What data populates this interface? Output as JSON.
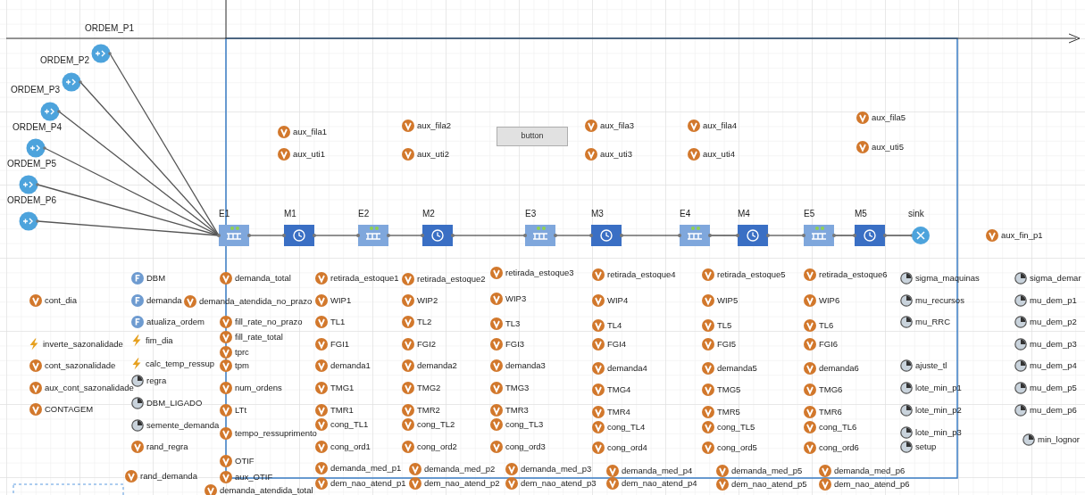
{
  "flowchart": {
    "blocks": [
      {
        "kind": "source",
        "label": "ORDEM_P1"
      },
      {
        "kind": "source",
        "label": "ORDEM_P2"
      },
      {
        "kind": "source",
        "label": "ORDEM_P3"
      },
      {
        "kind": "source",
        "label": "ORDEM_P4"
      },
      {
        "kind": "source",
        "label": "ORDEM_P5"
      },
      {
        "kind": "source",
        "label": "ORDEM_P6"
      },
      {
        "kind": "queue",
        "label": "E1"
      },
      {
        "kind": "delay",
        "label": "M1"
      },
      {
        "kind": "queue",
        "label": "E2"
      },
      {
        "kind": "delay",
        "label": "M2"
      },
      {
        "kind": "queue",
        "label": "E3"
      },
      {
        "kind": "delay",
        "label": "M3"
      },
      {
        "kind": "queue",
        "label": "E4"
      },
      {
        "kind": "delay",
        "label": "M4"
      },
      {
        "kind": "queue",
        "label": "E5"
      },
      {
        "kind": "delay",
        "label": "M5"
      },
      {
        "kind": "sink",
        "label": "sink"
      }
    ]
  },
  "button": {
    "label": "button"
  },
  "elements": [
    {
      "kind": "variable",
      "name": "aux_fila1"
    },
    {
      "kind": "variable",
      "name": "aux_uti1"
    },
    {
      "kind": "variable",
      "name": "aux_fila2"
    },
    {
      "kind": "variable",
      "name": "aux_uti2"
    },
    {
      "kind": "variable",
      "name": "aux_fila3"
    },
    {
      "kind": "variable",
      "name": "aux_uti3"
    },
    {
      "kind": "variable",
      "name": "aux_fila4"
    },
    {
      "kind": "variable",
      "name": "aux_uti4"
    },
    {
      "kind": "variable",
      "name": "aux_fila5"
    },
    {
      "kind": "variable",
      "name": "aux_uti5"
    },
    {
      "kind": "variable",
      "name": "aux_fin_p1"
    },
    {
      "kind": "variable",
      "name": "cont_dia"
    },
    {
      "kind": "event",
      "name": "inverte_sazonalidade"
    },
    {
      "kind": "variable",
      "name": "cont_sazonalidade"
    },
    {
      "kind": "variable",
      "name": "aux_cont_sazonalidade"
    },
    {
      "kind": "variable",
      "name": "CONTAGEM"
    },
    {
      "kind": "function",
      "name": "DBM"
    },
    {
      "kind": "function",
      "name": "demanda"
    },
    {
      "kind": "function",
      "name": "atualiza_ordem"
    },
    {
      "kind": "event",
      "name": "fim_dia"
    },
    {
      "kind": "event",
      "name": "calc_temp_ressup"
    },
    {
      "kind": "parameter",
      "name": "regra"
    },
    {
      "kind": "parameter",
      "name": "DBM_LIGADO"
    },
    {
      "kind": "parameter",
      "name": "semente_demanda"
    },
    {
      "kind": "variable",
      "name": "rand_regra"
    },
    {
      "kind": "variable",
      "name": "rand_demanda"
    },
    {
      "kind": "variable",
      "name": "demanda_total"
    },
    {
      "kind": "variable",
      "name": "demanda_atendida_no_prazo"
    },
    {
      "kind": "variable",
      "name": "fill_rate_no_prazo"
    },
    {
      "kind": "variable",
      "name": "fill_rate_total"
    },
    {
      "kind": "variable",
      "name": "tprc"
    },
    {
      "kind": "variable",
      "name": "tpm"
    },
    {
      "kind": "variable",
      "name": "num_ordens"
    },
    {
      "kind": "variable",
      "name": "LTt"
    },
    {
      "kind": "variable",
      "name": "tempo_ressuprimento"
    },
    {
      "kind": "variable",
      "name": "OTIF"
    },
    {
      "kind": "variable",
      "name": "aux_OTIF"
    },
    {
      "kind": "variable",
      "name": "demanda_atendida_total"
    },
    {
      "kind": "variable",
      "name": "retirada_estoque1"
    },
    {
      "kind": "variable",
      "name": "WIP1"
    },
    {
      "kind": "variable",
      "name": "TL1"
    },
    {
      "kind": "variable",
      "name": "FGI1"
    },
    {
      "kind": "variable",
      "name": "demanda1"
    },
    {
      "kind": "variable",
      "name": "TMG1"
    },
    {
      "kind": "variable",
      "name": "TMR1"
    },
    {
      "kind": "variable",
      "name": "cong_TL1"
    },
    {
      "kind": "variable",
      "name": "cong_ord1"
    },
    {
      "kind": "variable",
      "name": "demanda_med_p1"
    },
    {
      "kind": "variable",
      "name": "dem_nao_atend_p1"
    },
    {
      "kind": "variable",
      "name": "retirada_estoque2"
    },
    {
      "kind": "variable",
      "name": "WIP2"
    },
    {
      "kind": "variable",
      "name": "TL2"
    },
    {
      "kind": "variable",
      "name": "FGI2"
    },
    {
      "kind": "variable",
      "name": "demanda2"
    },
    {
      "kind": "variable",
      "name": "TMG2"
    },
    {
      "kind": "variable",
      "name": "TMR2"
    },
    {
      "kind": "variable",
      "name": "cong_TL2"
    },
    {
      "kind": "variable",
      "name": "cong_ord2"
    },
    {
      "kind": "variable",
      "name": "demanda_med_p2"
    },
    {
      "kind": "variable",
      "name": "dem_nao_atend_p2"
    },
    {
      "kind": "variable",
      "name": "retirada_estoque3"
    },
    {
      "kind": "variable",
      "name": "WIP3"
    },
    {
      "kind": "variable",
      "name": "TL3"
    },
    {
      "kind": "variable",
      "name": "FGI3"
    },
    {
      "kind": "variable",
      "name": "demanda3"
    },
    {
      "kind": "variable",
      "name": "TMG3"
    },
    {
      "kind": "variable",
      "name": "TMR3"
    },
    {
      "kind": "variable",
      "name": "cong_TL3"
    },
    {
      "kind": "variable",
      "name": "cong_ord3"
    },
    {
      "kind": "variable",
      "name": "demanda_med_p3"
    },
    {
      "kind": "variable",
      "name": "dem_nao_atend_p3"
    },
    {
      "kind": "variable",
      "name": "retirada_estoque4"
    },
    {
      "kind": "variable",
      "name": "WIP4"
    },
    {
      "kind": "variable",
      "name": "TL4"
    },
    {
      "kind": "variable",
      "name": "FGI4"
    },
    {
      "kind": "variable",
      "name": "demanda4"
    },
    {
      "kind": "variable",
      "name": "TMG4"
    },
    {
      "kind": "variable",
      "name": "TMR4"
    },
    {
      "kind": "variable",
      "name": "cong_TL4"
    },
    {
      "kind": "variable",
      "name": "cong_ord4"
    },
    {
      "kind": "variable",
      "name": "demanda_med_p4"
    },
    {
      "kind": "variable",
      "name": "dem_nao_atend_p4"
    },
    {
      "kind": "variable",
      "name": "retirada_estoque5"
    },
    {
      "kind": "variable",
      "name": "WIP5"
    },
    {
      "kind": "variable",
      "name": "TL5"
    },
    {
      "kind": "variable",
      "name": "FGI5"
    },
    {
      "kind": "variable",
      "name": "demanda5"
    },
    {
      "kind": "variable",
      "name": "TMG5"
    },
    {
      "kind": "variable",
      "name": "TMR5"
    },
    {
      "kind": "variable",
      "name": "cong_TL5"
    },
    {
      "kind": "variable",
      "name": "cong_ord5"
    },
    {
      "kind": "variable",
      "name": "demanda_med_p5"
    },
    {
      "kind": "variable",
      "name": "dem_nao_atend_p5"
    },
    {
      "kind": "variable",
      "name": "retirada_estoque6"
    },
    {
      "kind": "variable",
      "name": "WIP6"
    },
    {
      "kind": "variable",
      "name": "TL6"
    },
    {
      "kind": "variable",
      "name": "FGI6"
    },
    {
      "kind": "variable",
      "name": "demanda6"
    },
    {
      "kind": "variable",
      "name": "TMG6"
    },
    {
      "kind": "variable",
      "name": "TMR6"
    },
    {
      "kind": "variable",
      "name": "cong_TL6"
    },
    {
      "kind": "variable",
      "name": "cong_ord6"
    },
    {
      "kind": "variable",
      "name": "demanda_med_p6"
    },
    {
      "kind": "variable",
      "name": "dem_nao_atend_p6"
    },
    {
      "kind": "parameter",
      "name": "sigma_maquinas"
    },
    {
      "kind": "parameter",
      "name": "mu_recursos"
    },
    {
      "kind": "parameter",
      "name": "mu_RRC"
    },
    {
      "kind": "parameter",
      "name": "ajuste_tl"
    },
    {
      "kind": "parameter",
      "name": "lote_min_p1"
    },
    {
      "kind": "parameter",
      "name": "lote_min_p2"
    },
    {
      "kind": "parameter",
      "name": "lote_min_p3"
    },
    {
      "kind": "parameter",
      "name": "setup"
    },
    {
      "kind": "parameter",
      "name": "sigma_demar"
    },
    {
      "kind": "parameter",
      "name": "mu_dem_p1"
    },
    {
      "kind": "parameter",
      "name": "mu_dem_p2"
    },
    {
      "kind": "parameter",
      "name": "mu_dem_p3"
    },
    {
      "kind": "parameter",
      "name": "mu_dem_p4"
    },
    {
      "kind": "parameter",
      "name": "mu_dem_p5"
    },
    {
      "kind": "parameter",
      "name": "mu_dem_p6"
    },
    {
      "kind": "parameter",
      "name": "min_lognor"
    }
  ]
}
